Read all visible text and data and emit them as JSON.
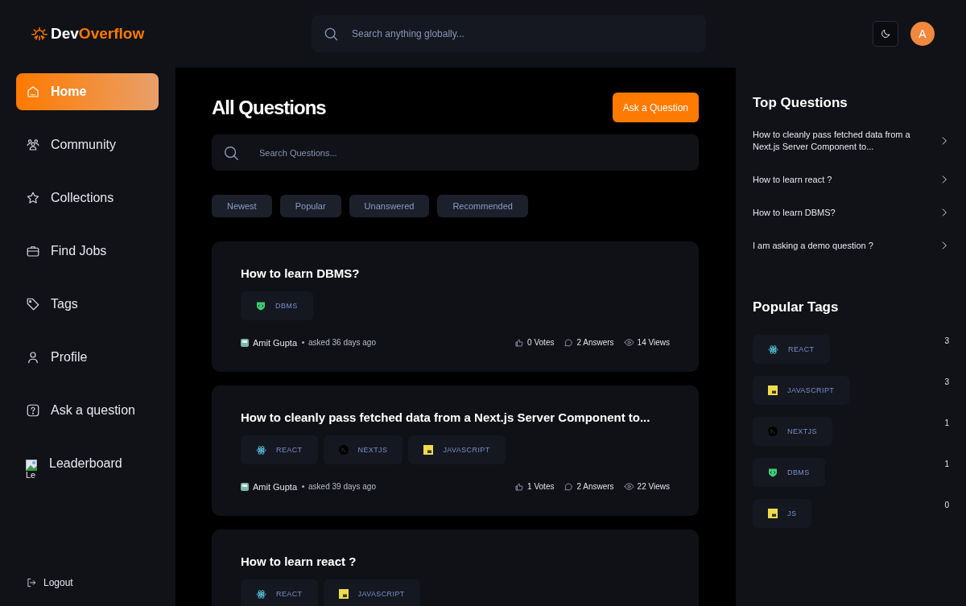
{
  "header": {
    "logo": {
      "part_1": "Dev",
      "part_2": "Overflow"
    },
    "search": {
      "placeholder": "Search anything globally..."
    },
    "avatar": "A"
  },
  "sidebar": {
    "items": [
      {
        "kind": "home",
        "label": "Home",
        "selected": true
      },
      {
        "kind": "community",
        "label": "Community",
        "selected": false
      },
      {
        "kind": "star",
        "label": "Collections",
        "selected": false
      },
      {
        "kind": "briefcase",
        "label": "Find Jobs",
        "selected": false
      },
      {
        "kind": "tag",
        "label": "Tags",
        "selected": false
      },
      {
        "kind": "user",
        "label": "Profile",
        "selected": false
      },
      {
        "kind": "question",
        "label": "Ask a question",
        "selected": false
      },
      {
        "kind": "broken-image",
        "label": "Leaderboard",
        "icon_alt": "Le",
        "selected": false
      }
    ],
    "logout": "Logout"
  },
  "main": {
    "title": "All Questions",
    "ask_button": "Ask a Question",
    "search": {
      "placeholder": "Search Questions..."
    },
    "filters": [
      {
        "label": "Newest",
        "selected": false
      },
      {
        "label": "Popular",
        "selected": false
      },
      {
        "label": "Unanswered",
        "selected": false
      },
      {
        "label": "Recommended",
        "selected": false
      }
    ],
    "questions": [
      {
        "title": "How to learn DBMS?",
        "tags": [
          {
            "kind": "dbms",
            "label": "DBMS"
          }
        ],
        "author": "Amit Gupta",
        "asked": "asked 36 days ago",
        "votes": "0 Votes",
        "answers": "2 Answers",
        "views": "14 Views"
      },
      {
        "title": "How to cleanly pass fetched data from a Next.js Server Component to...",
        "tags": [
          {
            "kind": "react",
            "label": "REACT"
          },
          {
            "kind": "nextjs",
            "label": "NEXTJS"
          },
          {
            "kind": "js",
            "label": "JAVASCRIPT"
          }
        ],
        "author": "Amit Gupta",
        "asked": "asked 39 days ago",
        "votes": "1 Votes",
        "answers": "2 Answers",
        "views": "22 Views"
      },
      {
        "title": "How to learn react ?",
        "tags": [
          {
            "kind": "react",
            "label": "REACT"
          },
          {
            "kind": "js",
            "label": "JAVASCRIPT"
          }
        ]
      }
    ]
  },
  "right": {
    "top_title": "Top Questions",
    "top_questions": [
      "How to cleanly pass fetched data from a Next.js Server Component to...",
      "How to learn react ?",
      "How to learn DBMS?",
      "I am asking a demo question ?"
    ],
    "tags_title": "Popular Tags",
    "tags": [
      {
        "kind": "react",
        "label": "REACT",
        "count": "3"
      },
      {
        "kind": "js",
        "label": "JAVASCRIPT",
        "count": "3"
      },
      {
        "kind": "nextjs",
        "label": "NEXTJS",
        "count": "1"
      },
      {
        "kind": "dbms",
        "label": "DBMS",
        "count": "1"
      },
      {
        "kind": "js",
        "label": "JS",
        "count": "0"
      }
    ]
  }
}
